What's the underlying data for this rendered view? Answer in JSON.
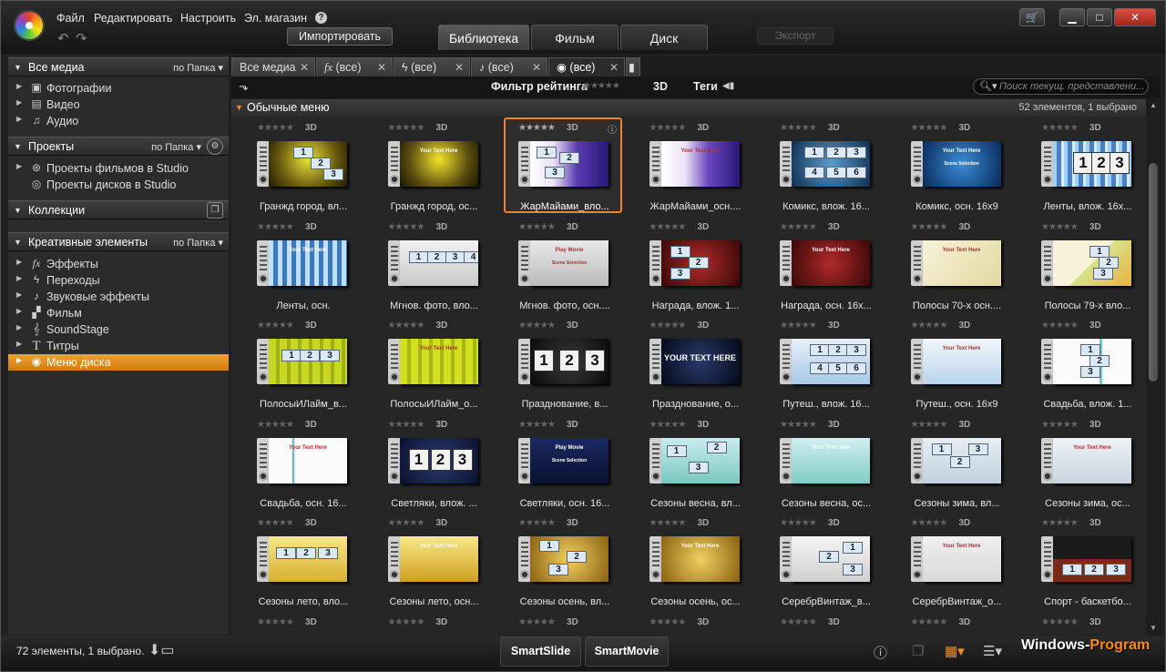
{
  "menu": [
    "Файл",
    "Редактировать",
    "Настроить",
    "Эл. магазин"
  ],
  "import_label": "Импортировать",
  "main_tabs": [
    "Библиотека",
    "Фильм",
    "Диск"
  ],
  "export_label": "Экспорт",
  "left": {
    "all_media": {
      "title": "Все медиа",
      "sort": "по Папка"
    },
    "media_items": [
      "Фотографии",
      "Видео",
      "Аудио"
    ],
    "projects": {
      "title": "Проекты",
      "sort": "по Папка"
    },
    "project_items": [
      "Проекты фильмов в Studio",
      "Проекты дисков в Studio"
    ],
    "collections": {
      "title": "Коллекции"
    },
    "creative": {
      "title": "Креативные элементы",
      "sort": "по Папка"
    },
    "creative_items": [
      "Эффекты",
      "Переходы",
      "Звуковые эффекты",
      "Фильм",
      "SoundStage",
      "Титры",
      "Меню диска"
    ]
  },
  "filter_tabs": [
    "Все медиа",
    "(все)",
    "(все)",
    "(все)",
    "(все)"
  ],
  "toolbar": {
    "rating_filter": "Фильтр рейтинга",
    "three_d": "3D",
    "tags": "Теги",
    "search_placeholder": "Поиск текущ. представлени..."
  },
  "group": {
    "title": "Обычные меню",
    "count": "52 элементов, 1 выбрано"
  },
  "tag_3d": "3D",
  "items": [
    "Гранжд город, вл...",
    "Гранжд город, ос...",
    "ЖарМайами_вло...",
    "ЖарМайами_осн....",
    "Комикс, влож. 16...",
    "Комикс, осн. 16x9",
    "Ленты, влож. 16x...",
    "Ленты, осн.",
    "Мгнов. фото, вло...",
    "Мгнов. фото, осн....",
    "Награда, влож. 1...",
    "Награда, осн. 16x...",
    "Полосы 70-х осн....",
    "Полосы 79-х вло...",
    "ПолосыИЛайм_в...",
    "ПолосыИЛайм_о...",
    "Празднование, в...",
    "Празднование, о...",
    "Путеш., влож. 16...",
    "Путеш., осн. 16x9",
    "Свадьба, влож. 1...",
    "Свадьба, осн. 16...",
    "Светляки, влож. ...",
    "Светляки, осн. 16...",
    "Сезоны весна, вл...",
    "Сезоны весна, ос...",
    "Сезоны зима, вл...",
    "Сезоны зима, ос...",
    "Сезоны лето, вло...",
    "Сезоны лето, осн...",
    "Сезоны осень, вл...",
    "Сезоны осень, ос...",
    "СеребрВинтаж_в...",
    "СеребрВинтаж_о...",
    "Спорт - баскетбо..."
  ],
  "thumb_text": {
    "your_text_here": "Your Text Here",
    "your_text_here_caps": "YOUR TEXT HERE",
    "play_movie": "Play Movie",
    "scene_selection": "Scene Selection",
    "n1": "1",
    "n2": "2",
    "n3": "3",
    "n4": "4",
    "n5": "5",
    "n6": "6"
  },
  "status": {
    "text": "72 элементы, 1 выбрано.",
    "smartslide": "SmartSlide",
    "smartmovie": "SmartMovie"
  },
  "watermark": {
    "a": "Windows-",
    "b": "Program"
  }
}
